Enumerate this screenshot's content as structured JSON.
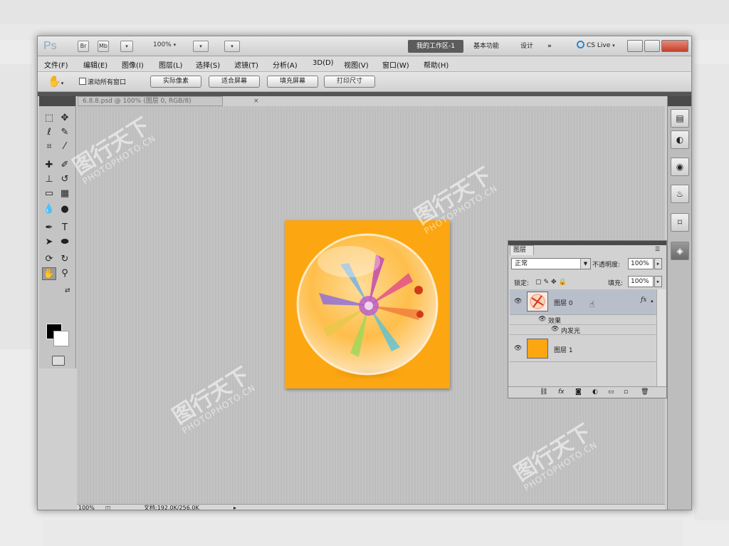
{
  "titlebar": {
    "app_logo": "Ps",
    "zoom_level": "100%",
    "workspaces": {
      "active": "我的工作区-1",
      "basic": "基本功能",
      "design": "设计",
      "more": "»"
    },
    "cs_live": "CS Live"
  },
  "menu": {
    "items": [
      "文件(F)",
      "编辑(E)",
      "图像(I)",
      "图层(L)",
      "选择(S)",
      "滤镜(T)",
      "分析(A)",
      "3D(D)",
      "视图(V)",
      "窗口(W)",
      "帮助(H)"
    ]
  },
  "options_bar": {
    "scroll_all_windows": "滚动所有窗口",
    "buttons": [
      "实际像素",
      "适合屏幕",
      "填充屏幕",
      "打印尺寸"
    ]
  },
  "document": {
    "tab_title": "6.8.8.psd @ 100% (图层 0, RGB/8)",
    "close": "×",
    "background_color": "#fca612"
  },
  "status_bar": {
    "zoom": "100%",
    "doc_info": "文档:192.0K/256.0K"
  },
  "layers_panel": {
    "tab_label": "图层",
    "blend_mode": "正常",
    "opacity_label": "不透明度:",
    "opacity_value": "100%",
    "lock_label": "锁定:",
    "fill_label": "填充:",
    "fill_value": "100%",
    "layers": [
      {
        "name": "图层 0",
        "fx": "fx",
        "selected": true
      },
      {
        "name": "图层 1",
        "thumb_color": "#fca612",
        "selected": false
      }
    ],
    "effects_label": "效果",
    "inner_glow_label": "内发光"
  },
  "watermark": {
    "cn": "图行天下",
    "en": "PHOTOPHOTO.CN"
  },
  "colors": {
    "foreground": "#000000",
    "background": "#ffffff",
    "ws_active_bg": "#5c5c5c"
  }
}
